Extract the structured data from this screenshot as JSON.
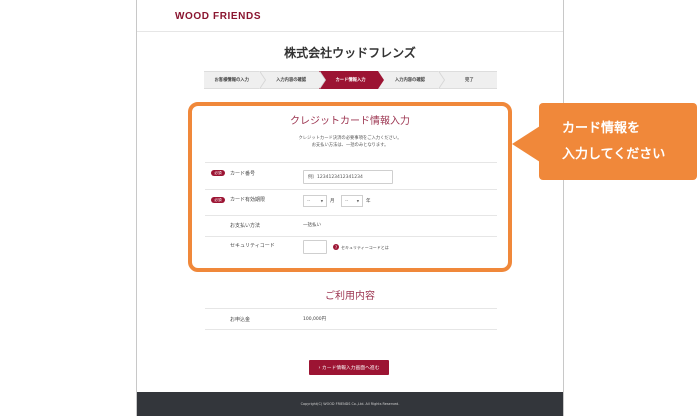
{
  "header": {
    "logo": "WOOD FRIENDS"
  },
  "company_name": "株式会社ウッドフレンズ",
  "steps": [
    {
      "label": "お客様情報の入力"
    },
    {
      "label": "入力内容の確認"
    },
    {
      "label": "カード情報入力",
      "active": true
    },
    {
      "label": "入力内容の確認"
    },
    {
      "label": "完了"
    }
  ],
  "card_section": {
    "title": "クレジットカード情報入力",
    "lead_line1": "クレジットカード決済の必要事項をご入力ください。",
    "lead_line2": "お支払い方法は、一括のみとなります。",
    "required_badge": "必須",
    "card_number_label": "カード番号",
    "card_number_value": "例）1234123412341234",
    "expiry_label": "カード有効期限",
    "month_value": "--",
    "month_unit": "月",
    "year_value": "--",
    "year_unit": "年",
    "payment_method_label": "お支払い方法",
    "payment_method_value": "一括払い",
    "security_code_label": "セキュリティコード",
    "security_code_help": "セキュリティーコードとは",
    "info_mark": "?"
  },
  "usage_section": {
    "title": "ご利用内容",
    "amount_label": "お申込金",
    "amount_value": "100,000円"
  },
  "submit_button": "› カード情報入力画面へ進む",
  "footer": {
    "copyright": "Copyright(C) WOOD FRIENDS Co.,Ltd. All Rights Reserved."
  },
  "callout": {
    "line1": "カード情報を",
    "line2": "入力してください"
  },
  "colors": {
    "brand": "#9c1433",
    "accent": "#f0883a"
  }
}
